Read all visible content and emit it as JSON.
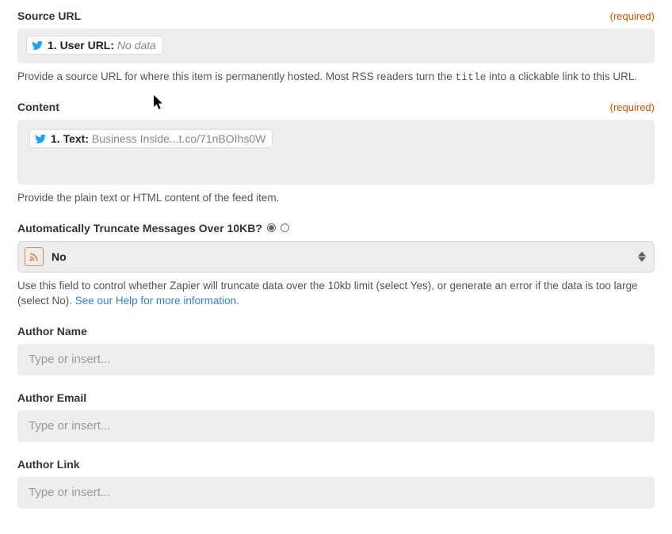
{
  "globals": {
    "required_label": "(required)",
    "placeholder": "Type or insert..."
  },
  "source_url": {
    "label": "Source URL",
    "pill_prefix": "1. User URL:",
    "pill_value": "No data",
    "help_before": "Provide a source URL for where this item is permanently hosted. Most RSS readers turn the ",
    "help_code": "title",
    "help_after": " into a clickable link to this URL."
  },
  "content": {
    "label": "Content",
    "pill_prefix": "1. Text:",
    "pill_value": "Business Inside...t.co/71nBOIhs0W",
    "help": "Provide the plain text or HTML content of the feed item."
  },
  "truncate": {
    "label": "Automatically Truncate Messages Over 10KB?",
    "selected": "No",
    "help_before": "Use this field to control whether Zapier will truncate data over the 10kb limit (select Yes), or generate an error if the data is too large (select No). ",
    "help_link": "See our Help for more information."
  },
  "author_name": {
    "label": "Author Name"
  },
  "author_email": {
    "label": "Author Email"
  },
  "author_link": {
    "label": "Author Link"
  }
}
